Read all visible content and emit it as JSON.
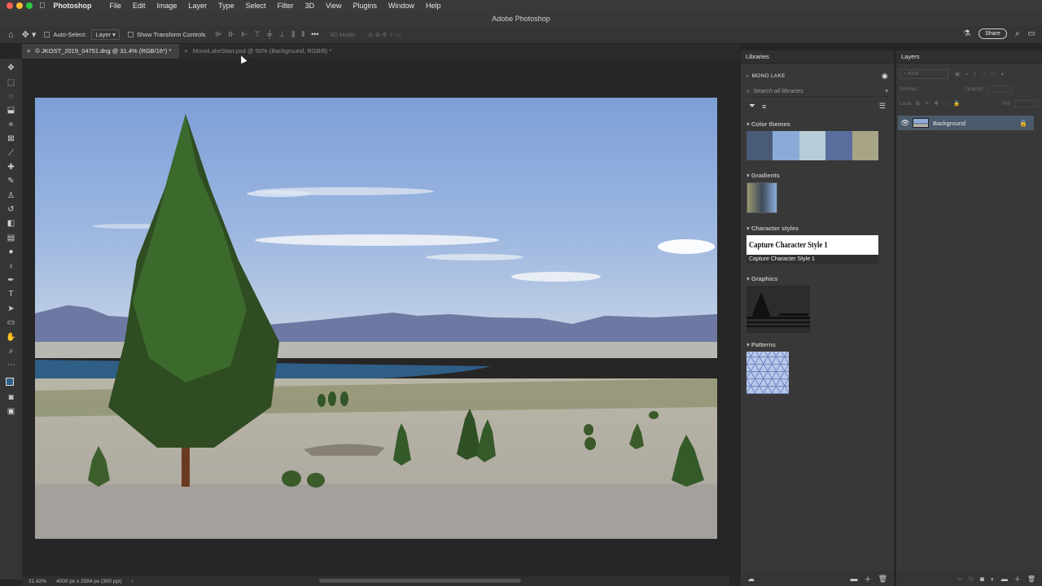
{
  "menubar": {
    "app_name": "Photoshop",
    "items": [
      "File",
      "Edit",
      "Image",
      "Layer",
      "Type",
      "Select",
      "Filter",
      "3D",
      "View",
      "Plugins",
      "Window",
      "Help"
    ]
  },
  "window": {
    "title": "Adobe Photoshop"
  },
  "options_bar": {
    "auto_select_label": "Auto-Select:",
    "auto_select_value": "Layer",
    "show_transform_label": "Show Transform Controls",
    "mode_3d_label": "3D Mode:",
    "share_label": "Share"
  },
  "tabs": [
    {
      "close": "×",
      "label": "© JKOST_2019_04751.dng @ 31.4% (RGB/16*) *",
      "active": true
    },
    {
      "close": "×",
      "label": "MonoLakeStart.psd @ 50% (Background, RGB/8) *",
      "active": false
    }
  ],
  "tools": [
    "move-tool",
    "marquee-tool",
    "lasso-tool",
    "object-select-tool",
    "crop-tool",
    "frame-tool",
    "eyedropper-tool",
    "healing-tool",
    "brush-tool",
    "stamp-tool",
    "history-brush-tool",
    "eraser-tool",
    "gradient-tool",
    "blur-tool",
    "dodge-tool",
    "pen-tool",
    "type-tool",
    "path-select-tool",
    "rectangle-tool",
    "hand-tool",
    "zoom-tool",
    "more-tools"
  ],
  "colors": {
    "foreground": "#2e5f8a",
    "background": "#ffffff",
    "panel_bg": "#383838",
    "selected_layer": "#4a5a6a"
  },
  "status": {
    "zoom": "31.42%",
    "doc_info": "4000 px x 2584 px (300 ppi)",
    "arrow": "›"
  },
  "libraries": {
    "panel_title": "Libraries",
    "library_name": "MONO LAKE",
    "search_placeholder": "Search all libraries",
    "sections": {
      "color_themes": "Color themes",
      "gradients": "Gradients",
      "character_styles": "Character styles",
      "graphics": "Graphics",
      "patterns": "Patterns"
    },
    "color_theme_swatches": [
      "#4a5b78",
      "#8aaad8",
      "#b8ccd8",
      "#5a6e9e",
      "#a8a486"
    ],
    "character_style_preview": "Capture Character Style 1",
    "character_style_name": "Capture Character Style 1"
  },
  "layers": {
    "panel_title": "Layers",
    "kind_label": "Kind",
    "blend_mode": "Normal",
    "opacity_label": "Opacity:",
    "lock_label": "Lock:",
    "fill_label": "Fill:",
    "items": [
      {
        "name": "Background",
        "visible": true,
        "locked": true,
        "selected": true
      }
    ]
  }
}
